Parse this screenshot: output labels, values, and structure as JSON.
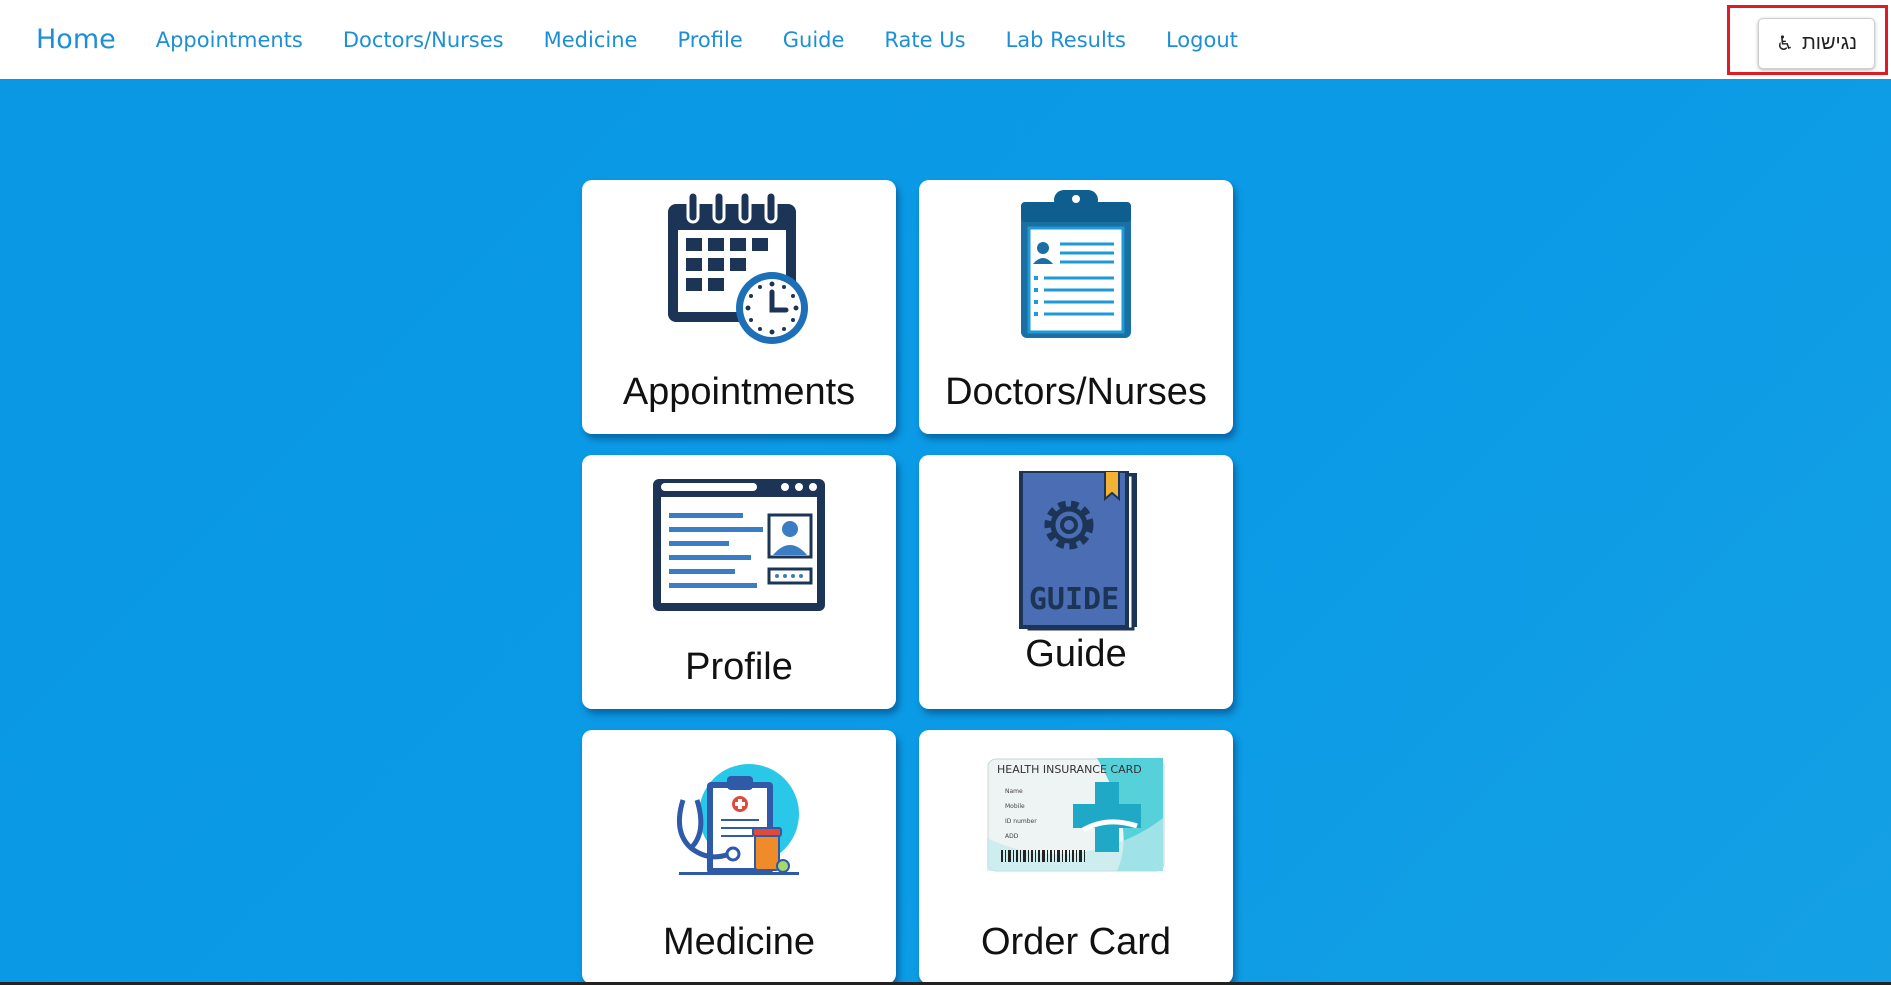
{
  "navbar": {
    "brand": "Home",
    "links": [
      "Appointments",
      "Doctors/Nurses",
      "Medicine",
      "Profile",
      "Guide",
      "Rate Us",
      "Lab Results",
      "Logout"
    ],
    "accessibility_button": {
      "label": "נגישות",
      "icon": "wheelchair-icon"
    }
  },
  "cards": [
    {
      "label": "Appointments",
      "icon": "calendar-clock-icon"
    },
    {
      "label": "Doctors/Nurses",
      "icon": "clipboard-profile-icon"
    },
    {
      "label": "Profile",
      "icon": "id-browser-icon"
    },
    {
      "label": "Guide",
      "icon": "guide-book-icon"
    },
    {
      "label": "Medicine",
      "icon": "medical-clipboard-icon"
    },
    {
      "label": "Order Card",
      "icon": "health-insurance-card-icon"
    }
  ],
  "insurance_card": {
    "title": "HEALTH INSURANCE CARD",
    "fields": [
      "Name",
      "Mobile",
      "ID number",
      "ADD"
    ]
  },
  "guide_book_text": "GUIDE",
  "colors": {
    "background": "#0a99e6",
    "nav_link": "#1d8fd6",
    "highlight_outline": "#e01b24",
    "icon_dark": "#1c3557"
  }
}
